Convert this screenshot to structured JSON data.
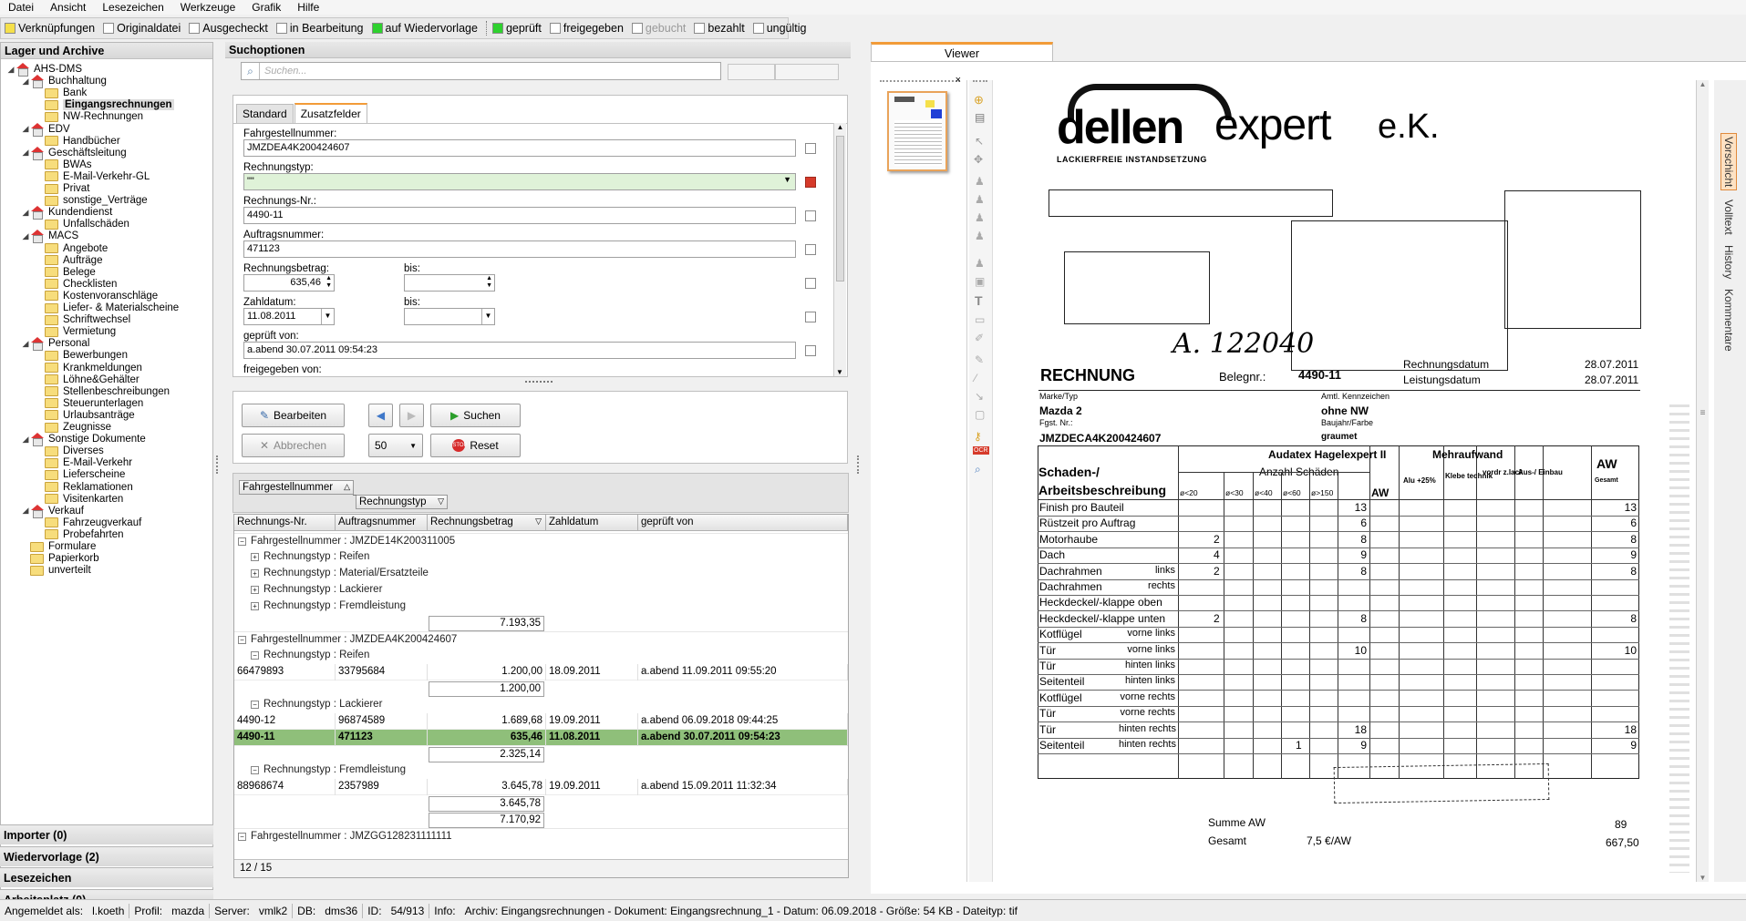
{
  "menu": [
    "Datei",
    "Ansicht",
    "Lesezeichen",
    "Werkzeuge",
    "Grafik",
    "Hilfe"
  ],
  "filters": [
    {
      "label": "Verknüpfungen",
      "color": "#f5e04a"
    },
    {
      "label": "Originaldatei",
      "color": "#ffffff"
    },
    {
      "label": "Ausgecheckt",
      "color": "#ffffff"
    },
    {
      "label": "in Bearbeitung",
      "color": "#ffffff"
    },
    {
      "label": "auf Wiedervorlage",
      "color": "#2ed12e"
    },
    {
      "label": "geprüft",
      "color": "#2ed12e"
    },
    {
      "label": "freigegeben",
      "color": "#ffffff"
    },
    {
      "label": "gebucht",
      "color": "#ffffff"
    },
    {
      "label": "bezahlt",
      "color": "#ffffff"
    },
    {
      "label": "ungültig",
      "color": "#ffffff"
    }
  ],
  "left": {
    "header": "Lager und Archive",
    "tree": [
      {
        "label": "AHS-DMS",
        "level": 0,
        "type": "home",
        "exp": "◢"
      },
      {
        "label": "Buchhaltung",
        "level": 1,
        "type": "home",
        "exp": "◢"
      },
      {
        "label": "Bank",
        "level": 2,
        "type": "folder"
      },
      {
        "label": "Eingangsrechnungen",
        "level": 2,
        "type": "folder",
        "sel": true
      },
      {
        "label": "NW-Rechnungen",
        "level": 2,
        "type": "folder"
      },
      {
        "label": "EDV",
        "level": 1,
        "type": "home",
        "exp": "◢"
      },
      {
        "label": "Handbücher",
        "level": 2,
        "type": "folder"
      },
      {
        "label": "Geschäftsleitung",
        "level": 1,
        "type": "home",
        "exp": "◢"
      },
      {
        "label": "BWAs",
        "level": 2,
        "type": "folder"
      },
      {
        "label": "E-Mail-Verkehr-GL",
        "level": 2,
        "type": "folder"
      },
      {
        "label": "Privat",
        "level": 2,
        "type": "folder"
      },
      {
        "label": "sonstige_Verträge",
        "level": 2,
        "type": "folder"
      },
      {
        "label": "Kundendienst",
        "level": 1,
        "type": "home",
        "exp": "◢"
      },
      {
        "label": "Unfallschäden",
        "level": 2,
        "type": "folder"
      },
      {
        "label": "MACS",
        "level": 1,
        "type": "home",
        "exp": "◢"
      },
      {
        "label": "Angebote",
        "level": 2,
        "type": "folder"
      },
      {
        "label": "Aufträge",
        "level": 2,
        "type": "folder"
      },
      {
        "label": "Belege",
        "level": 2,
        "type": "folder"
      },
      {
        "label": "Checklisten",
        "level": 2,
        "type": "folder"
      },
      {
        "label": "Kostenvoranschläge",
        "level": 2,
        "type": "folder"
      },
      {
        "label": "Liefer- & Materialscheine",
        "level": 2,
        "type": "folder"
      },
      {
        "label": "Schriftwechsel",
        "level": 2,
        "type": "folder"
      },
      {
        "label": "Vermietung",
        "level": 2,
        "type": "folder"
      },
      {
        "label": "Personal",
        "level": 1,
        "type": "home",
        "exp": "◢"
      },
      {
        "label": "Bewerbungen",
        "level": 2,
        "type": "folder"
      },
      {
        "label": "Krankmeldungen",
        "level": 2,
        "type": "folder"
      },
      {
        "label": "Löhne&Gehälter",
        "level": 2,
        "type": "folder"
      },
      {
        "label": "Stellenbeschreibungen",
        "level": 2,
        "type": "folder"
      },
      {
        "label": "Steuerunterlagen",
        "level": 2,
        "type": "folder"
      },
      {
        "label": "Urlaubsanträge",
        "level": 2,
        "type": "folder"
      },
      {
        "label": "Zeugnisse",
        "level": 2,
        "type": "folder"
      },
      {
        "label": "Sonstige Dokumente",
        "level": 1,
        "type": "home",
        "exp": "◢"
      },
      {
        "label": "Diverses",
        "level": 2,
        "type": "folder"
      },
      {
        "label": "E-Mail-Verkehr",
        "level": 2,
        "type": "folder"
      },
      {
        "label": "Lieferscheine",
        "level": 2,
        "type": "folder"
      },
      {
        "label": "Reklamationen",
        "level": 2,
        "type": "folder"
      },
      {
        "label": "Visitenkarten",
        "level": 2,
        "type": "folder"
      },
      {
        "label": "Verkauf",
        "level": 1,
        "type": "home",
        "exp": "◢"
      },
      {
        "label": "Fahrzeugverkauf",
        "level": 2,
        "type": "folder"
      },
      {
        "label": "Probefahrten",
        "level": 2,
        "type": "folder"
      },
      {
        "label": "Formulare",
        "level": 1,
        "type": "folder"
      },
      {
        "label": "Papierkorb",
        "level": 1,
        "type": "folder"
      },
      {
        "label": "unverteilt",
        "level": 1,
        "type": "folder"
      }
    ],
    "accordions": [
      "Importer (0)",
      "Wiedervorlage (2)",
      "Lesezeichen",
      "Arbeitsplatz (0)"
    ]
  },
  "search": {
    "header": "Suchoptionen",
    "placeholder": "Suchen...",
    "tabs": [
      "Standard",
      "Zusatzfelder"
    ],
    "fields": {
      "fin_label": "Fahrgestellnummer:",
      "fin_value": "JMZDEA4K200424607",
      "type_label": "Rechnungstyp:",
      "type_value": "\"\"",
      "nr_label": "Rechnungs-Nr.:",
      "nr_value": "4490-11",
      "auftrag_label": "Auftragsnummer:",
      "auftrag_value": "471123",
      "betrag_label": "Rechnungsbetrag:",
      "betrag_value": "635,46",
      "bis1": "bis:",
      "zahl_label": "Zahldatum:",
      "zahl_value": "11.08.2011",
      "bis2": "bis:",
      "gepr_label": "geprüft von:",
      "gepr_value": "a.abend 30.07.2011 09:54:23",
      "frei_label": "freigegeben von:"
    },
    "buttons": {
      "edit": "Bearbeiten",
      "cancel": "Abbrechen",
      "search": "Suchen",
      "reset": "Reset",
      "page_size": "50"
    }
  },
  "results": {
    "group_chips": [
      "Fahrgestellnummer",
      "Rechnungstyp"
    ],
    "columns": [
      "Rechnungs-Nr.",
      "Auftragsnummer",
      "Rechnungsbetrag",
      "Zahldatum",
      "geprüft von"
    ],
    "rows": [
      {
        "kind": "g1",
        "pm": "−",
        "text": "Fahrgestellnummer : JMZDE14K200311005"
      },
      {
        "kind": "g2",
        "pm": "+",
        "text": "Rechnungstyp : Reifen"
      },
      {
        "kind": "g2",
        "pm": "+",
        "text": "Rechnungstyp : Material/Ersatzteile"
      },
      {
        "kind": "g2",
        "pm": "+",
        "text": "Rechnungstyp : Lackierer"
      },
      {
        "kind": "g2",
        "pm": "+",
        "text": "Rechnungstyp : Fremdleistung"
      },
      {
        "kind": "sum",
        "text": "7.193,35"
      },
      {
        "kind": "g1",
        "pm": "−",
        "text": "Fahrgestellnummer : JMZDEA4K200424607"
      },
      {
        "kind": "g2",
        "pm": "−",
        "text": "Rechnungstyp : Reifen"
      },
      {
        "kind": "data",
        "cells": [
          "66479893",
          "33795684",
          "1.200,00",
          "18.09.2011",
          "a.abend 11.09.2011 09:55:20"
        ]
      },
      {
        "kind": "sum",
        "text": "1.200,00"
      },
      {
        "kind": "g2",
        "pm": "−",
        "text": "Rechnungstyp : Lackierer"
      },
      {
        "kind": "data",
        "cells": [
          "4490-12",
          "96874589",
          "1.689,68",
          "19.09.2011",
          "a.abend 06.09.2018 09:44:25"
        ]
      },
      {
        "kind": "data",
        "hl": true,
        "cells": [
          "4490-11",
          "471123",
          "635,46",
          "11.08.2011",
          "a.abend 30.07.2011 09:54:23"
        ]
      },
      {
        "kind": "sum",
        "text": "2.325,14"
      },
      {
        "kind": "g2",
        "pm": "−",
        "text": "Rechnungstyp : Fremdleistung"
      },
      {
        "kind": "data",
        "cells": [
          "88968674",
          "2357989",
          "3.645,78",
          "19.09.2011",
          "a.abend 15.09.2011 11:32:34"
        ]
      },
      {
        "kind": "sum",
        "text": "3.645,78"
      },
      {
        "kind": "sum",
        "text": "7.170,92"
      },
      {
        "kind": "g1",
        "pm": "−",
        "text": "Fahrgestellnummer : JMZGG128231111111"
      }
    ],
    "pager": "12 / 15"
  },
  "viewer": {
    "tab": "Viewer",
    "side_tabs": [
      "Vorschicht",
      "Volltext",
      "History",
      "Kommentare"
    ],
    "doc": {
      "logo_bold": "dellen",
      "logo_light": "expert",
      "logo_suffix": "e.K.",
      "tagline": "LACKIERFREIE INSTANDSETZUNG",
      "handwritten": "A. 122040",
      "rechnung": "RECHNUNG",
      "belegnr_label": "Belegnr.:",
      "belegnr": "4490-11",
      "rdatum_label": "Rechnungsdatum",
      "rdatum": "28.07.2011",
      "ldatum_label": "Leistungsdatum",
      "ldatum": "28.07.2011",
      "marke_label": "Marke/Typ",
      "marke": "Mazda 2",
      "kennz_label": "Amtl. Kennzeichen",
      "kennz": "ohne NW",
      "fgst_label": "Fgst. Nr.:",
      "fgst": "JMZDECA4K200424607",
      "farbe_label": "Baujahr/Farbe",
      "farbe": "graumet",
      "audatex": "Audatex Hagelexpert II",
      "mehraufwand": "Mehraufwand",
      "schaden": "Schaden-/",
      "arbeits": "Arbeitsbeschreibung",
      "anzahl": "Anzahl Schäden",
      "aw": "AW",
      "gesamt": "Gesamt",
      "alu": "Alu +25%",
      "klebe": "Klebe technik",
      "vordr": "vordr z.lack",
      "ausein": "Aus-/ Einbau",
      "sizes": [
        "ø<20",
        "ø<30",
        "ø<40",
        "ø<60",
        "ø>150"
      ],
      "lines": [
        {
          "t": "Finish pro Bauteil",
          "s": "",
          "c1": "",
          "aw": "13",
          "tot": "13"
        },
        {
          "t": "Rüstzeit pro Auftrag",
          "s": "",
          "c1": "",
          "aw": "6",
          "tot": "6"
        },
        {
          "t": "Motorhaube",
          "s": "",
          "c1": "2",
          "aw": "8",
          "tot": "8"
        },
        {
          "t": "Dach",
          "s": "",
          "c1": "4",
          "aw": "9",
          "tot": "9"
        },
        {
          "t": "Dachrahmen",
          "s": "links",
          "c1": "2",
          "aw": "8",
          "tot": "8"
        },
        {
          "t": "Dachrahmen",
          "s": "rechts",
          "c1": "",
          "aw": "",
          "tot": ""
        },
        {
          "t": "Heckdeckel/-klappe  oben",
          "s": "",
          "c1": "",
          "aw": "",
          "tot": ""
        },
        {
          "t": "Heckdeckel/-klappe unten",
          "s": "",
          "c1": "2",
          "aw": "8",
          "tot": "8"
        },
        {
          "t": "Kotflügel",
          "s": "vorne links",
          "c1": "",
          "aw": "",
          "tot": ""
        },
        {
          "t": "Tür",
          "s": "vorne links",
          "c1": "",
          "aw": "10",
          "tot": "10"
        },
        {
          "t": "Tür",
          "s": "hinten links",
          "c1": "",
          "aw": "",
          "tot": ""
        },
        {
          "t": "Seitenteil",
          "s": "hinten links",
          "c1": "",
          "aw": "",
          "tot": ""
        },
        {
          "t": "Kotflügel",
          "s": "vorne rechts",
          "c1": "",
          "aw": "",
          "tot": ""
        },
        {
          "t": "Tür",
          "s": "vorne rechts",
          "c1": "",
          "aw": "",
          "tot": ""
        },
        {
          "t": "Tür",
          "s": "hinten rechts",
          "c1": "",
          "aw": "18",
          "tot": "18"
        },
        {
          "t": "Seitenteil",
          "s": "hinten rechts",
          "c1": "1",
          "aw": "9",
          "tot": "9"
        }
      ],
      "summe": "Summe AW",
      "summe_val": "89",
      "gesamt_label": "Gesamt",
      "rate": "7,5 €/AW",
      "gesamt_val": "667,50"
    }
  },
  "status": {
    "user_label": "Angemeldet als:",
    "user": "l.koeth",
    "profil_label": "Profil:",
    "profil": "mazda",
    "server_label": "Server:",
    "server": "vmlk2",
    "db_label": "DB:",
    "db": "dms36",
    "id_label": "ID:",
    "id": "54/913",
    "info_label": "Info:",
    "info": "Archiv: Eingangsrechnungen - Dokument: Eingangsrechnung_1 - Datum: 06.09.2018 - Größe: 54 KB - Dateityp: tif"
  }
}
